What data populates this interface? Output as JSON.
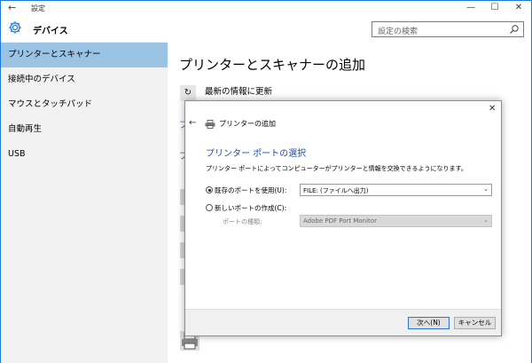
{
  "window": {
    "title": "設定",
    "controls": {
      "minimize": "—",
      "maximize": "☐",
      "close": "✕"
    }
  },
  "header": {
    "title": "デバイス",
    "search_placeholder": "設定の検索"
  },
  "sidebar": {
    "items": [
      {
        "label": "プリンターとスキャナー",
        "selected": true
      },
      {
        "label": "接続中のデバイス",
        "selected": false
      },
      {
        "label": "マウスとタッチパッド",
        "selected": false
      },
      {
        "label": "自動再生",
        "selected": false
      },
      {
        "label": "USB",
        "selected": false
      }
    ]
  },
  "main": {
    "title": "プリンターとスキャナーの追加",
    "refresh_label": "最新の情報に更新",
    "peek_link": "プ",
    "peek_text": "プ"
  },
  "dialog": {
    "title": "プリンターの追加",
    "heading": "プリンター ポートの選択",
    "description": "プリンター ポートによってコンピューターがプリンターと情報を交換できるようになります。",
    "options": {
      "existing_label": "既存のポートを使用(U):",
      "existing_value": "FILE: (ファイルへ出力)",
      "existing_checked": true,
      "new_label": "新しいポートの作成(C):",
      "new_checked": false,
      "port_type_label": "ポートの種類:",
      "port_type_value": "Adobe PDF Port Monitor"
    },
    "buttons": {
      "next": "次へ(N)",
      "cancel": "キャンセル"
    }
  },
  "colors": {
    "accent": "#1e7ad6",
    "selected_nav": "#9bc3e4",
    "heading_blue": "#1d4fa8"
  }
}
